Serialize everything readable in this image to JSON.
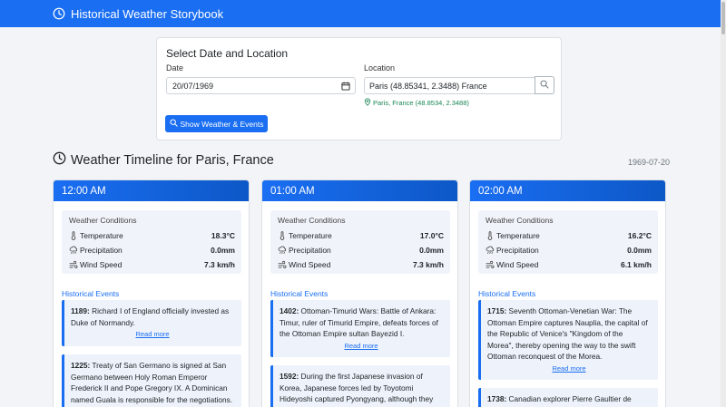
{
  "navbar": {
    "title": "Historical Weather Storybook"
  },
  "form": {
    "title": "Select Date and Location",
    "date_label": "Date",
    "date_value": "20/07/1969",
    "location_label": "Location",
    "location_value": "Paris (48.85341, 2.3488) France",
    "location_hint": "Paris, France (48.8534, 2.3488)",
    "submit_label": "Show Weather & Events"
  },
  "timeline": {
    "title": "Weather Timeline for Paris, France",
    "date": "1969-07-20"
  },
  "cards": [
    {
      "hour": "12:00 AM",
      "conditions_title": "Weather Conditions",
      "temperature_label": "Temperature",
      "temperature": "18.3°C",
      "precipitation_label": "Precipitation",
      "precipitation": "0.0mm",
      "wind_label": "Wind Speed",
      "wind": "7.3 km/h",
      "events_title": "Historical Events",
      "events": [
        {
          "year": "1189:",
          "text": "Richard I of England officially invested as Duke of Normandy.",
          "more": "Read more"
        },
        {
          "year": "1225:",
          "text": "Treaty of San Germano is signed at San Germano between Holy Roman Emperor Frederick II and Pope Gregory IX. A Dominican named Guala is responsible for the negotiations.",
          "more": ""
        }
      ]
    },
    {
      "hour": "01:00 AM",
      "conditions_title": "Weather Conditions",
      "temperature_label": "Temperature",
      "temperature": "17.0°C",
      "precipitation_label": "Precipitation",
      "precipitation": "0.0mm",
      "wind_label": "Wind Speed",
      "wind": "7.3 km/h",
      "events_title": "Historical Events",
      "events": [
        {
          "year": "1402:",
          "text": "Ottoman-Timurid Wars: Battle of Ankara: Timur, ruler of Timurid Empire, defeats forces of the Ottoman Empire sultan Bayezid I.",
          "more": "Read more"
        },
        {
          "year": "1592:",
          "text": "During the first Japanese invasion of Korea, Japanese forces led by Toyotomi Hideyoshi captured Pyongyang, although they",
          "more": ""
        }
      ]
    },
    {
      "hour": "02:00 AM",
      "conditions_title": "Weather Conditions",
      "temperature_label": "Temperature",
      "temperature": "16.2°C",
      "precipitation_label": "Precipitation",
      "precipitation": "0.0mm",
      "wind_label": "Wind Speed",
      "wind": "6.1 km/h",
      "events_title": "Historical Events",
      "events": [
        {
          "year": "1715:",
          "text": "Seventh Ottoman-Venetian War: The Ottoman Empire captures Nauplia, the capital of the Republic of Venice's \"Kingdom of the Morea\", thereby opening the way to the swift Ottoman reconquest of the Morea.",
          "more": "Read more"
        },
        {
          "year": "1738:",
          "text": "Canadian explorer Pierre Gaultier de",
          "more": ""
        }
      ]
    }
  ]
}
